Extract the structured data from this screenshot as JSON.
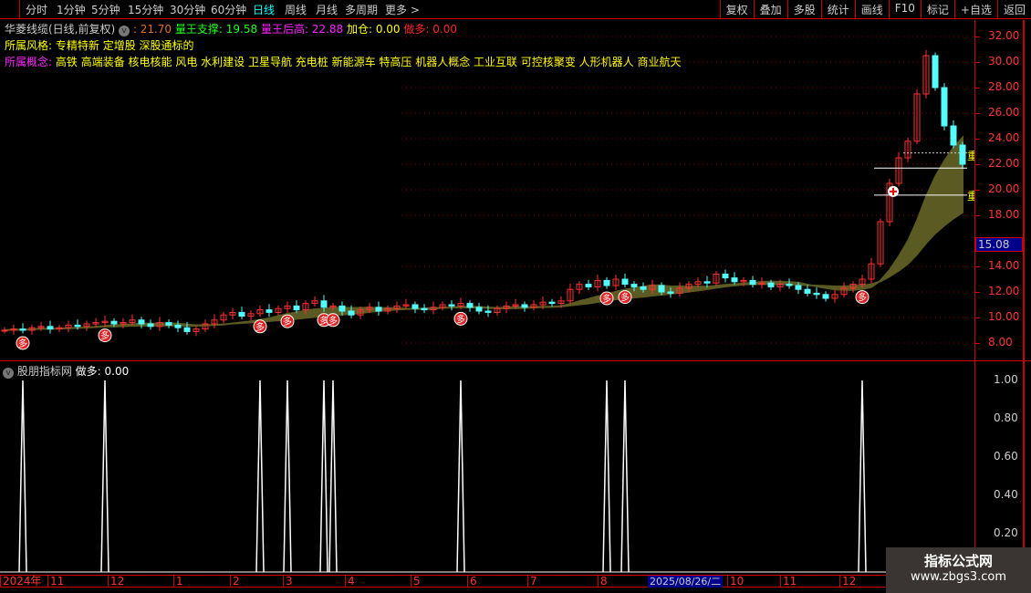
{
  "toolbar": {
    "periods": [
      "分时",
      "1分钟",
      "5分钟",
      "15分钟",
      "30分钟",
      "60分钟",
      "日线",
      "周线",
      "月线",
      "多周期",
      "更多 >"
    ],
    "active": "日线",
    "right_buttons": [
      "复权",
      "叠加",
      "多股",
      "统计",
      "画线",
      "F10",
      "标记",
      "+自选",
      "返回"
    ]
  },
  "indicator_line": {
    "name": "华菱线缆(日线,前复权)",
    "value": ": 21.70",
    "support_label": "量王支撑: 19.58",
    "high_label": "量王后高: 22.88",
    "add_label": "加仓: 0.00",
    "long_label": "做多: 0.00"
  },
  "style_line": {
    "label": "所属风格:",
    "value": "专精特新 定增股 深股通标的"
  },
  "concept_line": {
    "label": "所属概念:",
    "value": "高铁 高端装备 核电核能 风电 水利建设 卫星导航 充电桩 新能源车 特高压 机器人概念 工业互联 可控核聚变 人形机器人 商业航天"
  },
  "lower_pane": {
    "title": "股朋指标网",
    "label": "做多: 0.00"
  },
  "current_price": "15.08",
  "marker_char": "多",
  "weight_char": "重",
  "colors": {
    "up": "#ff3030",
    "down": "#54fcfc",
    "ma_band": "#5a5a22",
    "axis": "#cc0000",
    "signal": "#ffffff",
    "marker": "#e02020"
  },
  "watermark": {
    "title": "指标公式网",
    "url": "www.zbgs3.com"
  },
  "chart_data": [
    {
      "type": "candlestick",
      "ylim": [
        7,
        33
      ],
      "yticks": [
        "32.00",
        "30.00",
        "28.00",
        "26.00",
        "24.00",
        "22.00",
        "20.00",
        "18.00",
        "14.00",
        "12.00",
        "10.00",
        "8.00"
      ],
      "closes": [
        9.0,
        9.1,
        9.0,
        9.2,
        9.3,
        9.1,
        9.2,
        9.4,
        9.3,
        9.5,
        9.6,
        9.7,
        9.5,
        9.6,
        9.8,
        9.5,
        9.3,
        9.6,
        9.4,
        9.2,
        8.9,
        9.1,
        9.5,
        9.8,
        10.2,
        10.4,
        10.1,
        10.3,
        10.6,
        10.4,
        10.7,
        10.9,
        10.6,
        11.1,
        11.3,
        10.8,
        10.9,
        10.5,
        10.2,
        10.6,
        10.8,
        10.5,
        10.7,
        10.9,
        11.0,
        10.7,
        10.6,
        10.8,
        11.0,
        10.9,
        11.1,
        10.8,
        10.5,
        10.4,
        10.7,
        10.9,
        11.0,
        10.8,
        11.0,
        11.2,
        11.1,
        11.3,
        12.2,
        12.6,
        12.4,
        12.9,
        12.5,
        13.0,
        12.6,
        12.4,
        12.2,
        12.5,
        12.0,
        11.9,
        12.3,
        12.6,
        12.8,
        12.7,
        13.4,
        13.1,
        12.8,
        12.9,
        12.6,
        12.7,
        12.4,
        12.6,
        12.5,
        12.2,
        11.9,
        11.8,
        11.5,
        11.8,
        12.3,
        12.6,
        13.0,
        14.2,
        17.5,
        20.5,
        22.5,
        23.8,
        27.5,
        30.5,
        28.0,
        25.0,
        23.5,
        22.0
      ],
      "signal_bars": [
        2,
        11,
        28,
        31,
        35,
        36,
        50,
        66,
        68,
        94
      ],
      "support_level": 19.58,
      "high_level": 22.88,
      "last": 21.7
    },
    {
      "type": "line",
      "ylim": [
        0,
        1.05
      ],
      "yticks": [
        "1.00",
        "0.80",
        "0.60",
        "0.40",
        "0.20"
      ],
      "series": [
        {
          "name": "做多",
          "signal_bars": [
            2,
            11,
            28,
            31,
            35,
            36,
            50,
            66,
            68,
            94
          ],
          "value": 1
        }
      ]
    }
  ],
  "xaxis": {
    "labels": [
      "2024年",
      "11",
      "12",
      "1",
      "2",
      "3",
      "4",
      "5",
      "6",
      "7",
      "8",
      "10",
      "11",
      "12"
    ],
    "cursor_date": "2025/08/26/二"
  }
}
